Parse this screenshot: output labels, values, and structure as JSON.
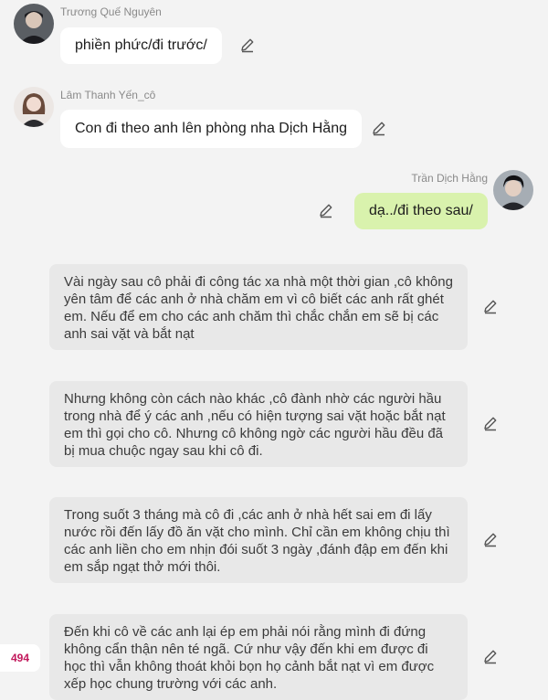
{
  "messages": [
    {
      "sender": "Trương Quế Nguyên",
      "text": "phiền phức/đi trước/",
      "avatar_icon": "male-avatar-icon"
    },
    {
      "sender": "Lâm Thanh Yến_cô",
      "text": "Con đi theo anh lên phòng nha Dịch Hằng",
      "avatar_icon": "female-avatar-icon"
    },
    {
      "sender": "Trần Dịch Hằng",
      "text": "dạ../đi theo sau/",
      "avatar_icon": "male-avatar-icon"
    }
  ],
  "narrations": [
    {
      "text": "Vài ngày sau cô phải đi công tác xa nhà một thời gian ,cô không yên tâm để các anh ở nhà chăm em vì cô biết các anh rất ghét em. Nếu để em cho các anh chăm thì chắc chắn em sẽ bị các anh sai vặt và bắt nạt"
    },
    {
      "text": "Nhưng không còn cách nào khác ,cô đành nhờ các người hầu trong nhà để ý các anh ,nếu có hiện tượng sai vặt hoặc bắt nạt em thì gọi cho cô. Nhưng cô không ngờ các người hầu đều đã bị mua chuộc ngay sau khi cô đi."
    },
    {
      "text": "Trong suốt 3 tháng mà cô đi ,các anh ở nhà hết sai em đi lấy nước rồi đến lấy đồ ăn vặt cho mình. Chỉ cần em không chịu thì các anh liền cho em nhịn đói suốt 3 ngày ,đánh đập em đến khi em sắp ngạt thở mới thôi."
    },
    {
      "text": "Đến khi cô về các anh lại ép em phải nói rằng mình đi đứng không cẩn thận nên té ngã. Cứ như vậy đến khi em được đi học thì vẫn không thoát khỏi bọn họ cảnh bắt nạt vì em được xếp học chung trường với các anh."
    }
  ],
  "badge": {
    "count": "494"
  },
  "colors": {
    "incoming_bubble": "#ffffff",
    "outgoing_bubble": "#d9f2ad",
    "narration_bg": "#e8e8e8",
    "badge_text": "#c2185b"
  }
}
